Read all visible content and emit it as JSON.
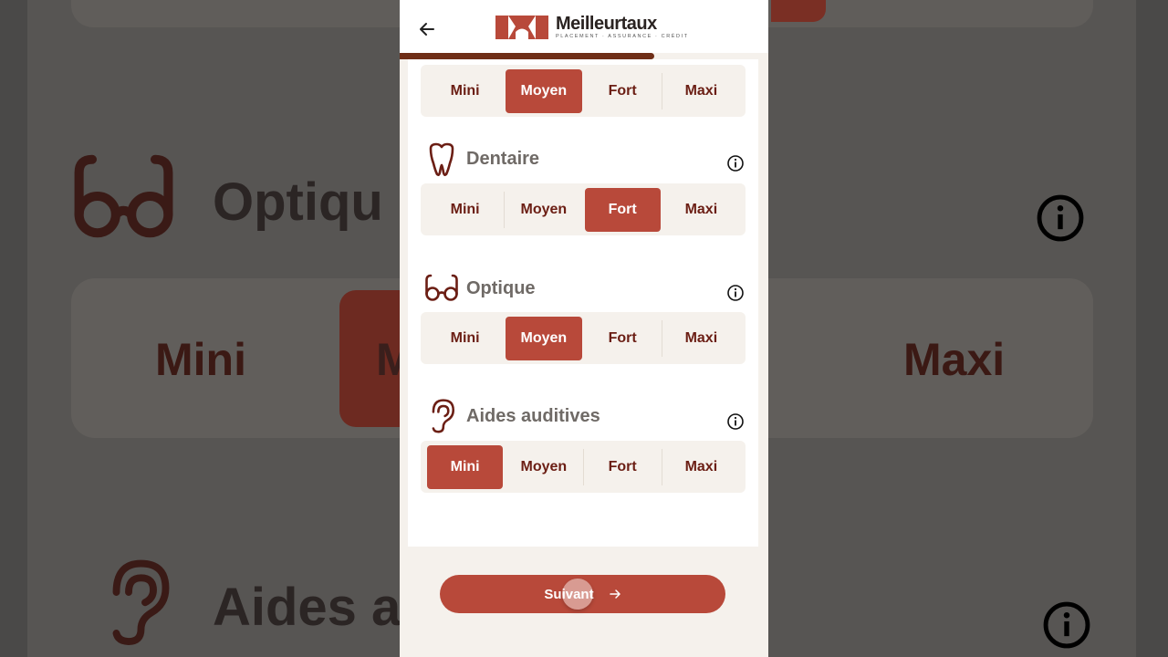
{
  "header": {
    "back_label": "back",
    "brand_name": "Meilleurtaux",
    "brand_tagline": "PLACEMENT · ASSURANCE · CRÉDIT",
    "progress_fraction": 0.69
  },
  "options": [
    "Mini",
    "Moyen",
    "Fort",
    "Maxi"
  ],
  "categories": [
    {
      "title": "",
      "selected": "Moyen",
      "icon": "unknown-icon"
    },
    {
      "title": "Dentaire",
      "selected": "Fort",
      "icon": "tooth-icon"
    },
    {
      "title": "Optique",
      "selected": "Moyen",
      "icon": "glasses-icon"
    },
    {
      "title": "Aides auditives",
      "selected": "Mini",
      "icon": "ear-icon"
    }
  ],
  "footer": {
    "next_label": "Suivant"
  },
  "background": {
    "optique_label": "Optiqu",
    "mini_label": "Mini",
    "moyen_partial": "M",
    "maxi_label": "Maxi",
    "aides_partial": "Aides a"
  },
  "colors": {
    "accent": "#b8493a",
    "option_text": "#6b1e14",
    "progress": "#6f2e17"
  }
}
